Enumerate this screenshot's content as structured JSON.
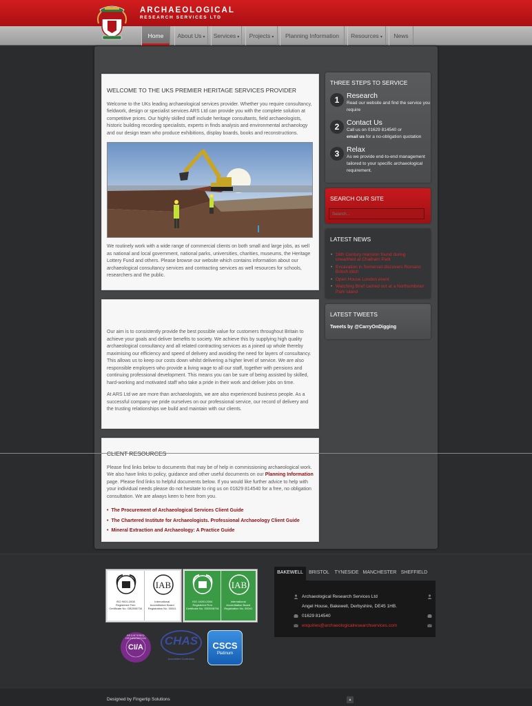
{
  "header": {
    "title_line1": "ARCHAEOLOGICAL",
    "title_line2": "RESEARCH SERVICES LTD"
  },
  "nav": {
    "items": [
      {
        "label": "Home",
        "active": true,
        "dropdown": false
      },
      {
        "label": "About Us",
        "active": false,
        "dropdown": true
      },
      {
        "label": "Services",
        "active": false,
        "dropdown": true
      },
      {
        "label": "Projects",
        "active": false,
        "dropdown": true
      },
      {
        "label": "Planning Information",
        "active": false,
        "dropdown": false
      },
      {
        "label": "Resources",
        "active": false,
        "dropdown": true
      },
      {
        "label": "News",
        "active": false,
        "dropdown": false
      }
    ],
    "caret": "▾"
  },
  "welcome": {
    "heading": "WELCOME TO THE UKS PREMIER HERITAGE SERVICES PROVIDER",
    "intro": "Welcome to the UKs leading archaeological services provider. Whether you require consultancy, fieldwork, design or specialist services ARS Ltd can provide you with the complete solution at competitive prices. Our highly skilled staff include heritage consultants, field archaeologists, historic building recording specialists, experts in finds analysis and environmental archaeology and our design team who produce exhibitions, display boards, books and reconstructions.",
    "body": "We routinely work with a wide range of commercial clients on both small and large jobs, as well as national and local government, national parks, universities, charities, museums, the Heritage Lottery Fund and others. Please browse our website which contains information about our archaeological consultancy services and contracting services as well resources for schools, researchers and the public."
  },
  "aim": {
    "p1": "Our aim is to consistently provide the best possible value for customers throughout Britain to achieve your goals and deliver benefits to society. We achieve this by supplying high quality archaeological consultancy and all related contracting services as a joined up whole thereby maximising our efficiency and speed of delivery and avoiding the need for layers of consultancy. This allows us to keep our costs down whilst delivering a higher level of service. We are also responsible employers who provide a living wage to all our staff, together with pensions and continuing professional development. This means you can be sure of being assisted by skilled, hard-working and motivated staff who take a pride in their work and deliver jobs on time.",
    "p2": "At ARS Ltd we are more than archaeologists, we are also experienced business people. As a successful company we pride ourselves on our professional service, our record of delivery and the trusting relationships we build and maintain with our clients."
  },
  "resources": {
    "heading": "CLIENT RESOURCES",
    "p1_start": "Please find links below to documents that may be of help in commissioning archaeological work. We also have links to policy, guidance and other useful documents on our ",
    "p1_link": "Planning Information",
    "p1_end": " page. Please find links to helpful documents below. If you would like further advice to help with your individual needs please do not hesitate to ring us on 01629 814540 for a free, no obligation consultation. We are always keen to here from you.",
    "links": [
      "The Procurement of Archaeological Services Client Guide",
      "The Chartered Institute for Archaeologists. Professional Archaeology Client Guide",
      "Mineral Extraction and Archaeology: A Practice Guide"
    ]
  },
  "steps": {
    "heading": "THREE STEPS TO SERVICE",
    "items": [
      {
        "num": "1",
        "title": "Research",
        "text": "Read our website and find the service you require"
      },
      {
        "num": "2",
        "title": "Contact Us",
        "text1": "Call us on 01629 814540 or",
        "text2_bold": "email us",
        "text2": " for a no-obligation quotation"
      },
      {
        "num": "3",
        "title": "Relax",
        "text": "As we provide end-to-end management tailored to your specific archaeological requirement."
      }
    ]
  },
  "search": {
    "heading": "SEARCH OUR SITE",
    "placeholder": "Search..."
  },
  "news": {
    "heading": "LATEST NEWS",
    "items": [
      "16th Century mansion found during unearthed at Chatham Park",
      "Excavation in Somerset discovers Romano British ditch",
      "Open House London event",
      "Watching Brief carried out at a Northumbrian Park island"
    ]
  },
  "tweets": {
    "heading": "LATEST TWEETS",
    "by": "Tweets by @CarryOnDigging"
  },
  "certs": {
    "cert1_left_a": "ISO 9001:2008",
    "cert1_left_b": "Registered Firm",
    "cert1_left_c": "Certificate No. GB2008734",
    "cert1_right_a": "International",
    "cert1_right_b": "Accreditation Board",
    "cert1_right_c": "Registration No. 00041",
    "cert2_left_a": "ISO 14001:2004",
    "cert2_left_b": "Registered Firm",
    "cert2_left_c": "Certificate No. GB2008734",
    "cert2_right_a": "International",
    "cert2_right_b": "Accreditation Board",
    "cert2_right_c": "Registration No. 00041",
    "cia_ring": "REGISTERED ORGANISATION",
    "cia": "CI/A",
    "chas": "CHAS",
    "chas_sub": "Accredited Contractor",
    "cscs": "CSCS",
    "cscs_sub": "Platinum"
  },
  "offices": {
    "tabs": [
      "BAKEWELL",
      "BRISTOL",
      "TYNESIDE",
      "MANCHESTER",
      "SHEFFIELD"
    ],
    "name": "Archaeological Research Services Ltd",
    "address": "Angel House, Bakewell, Derbyshire, DE45 1HB.",
    "phone": "01629 814540",
    "email": "enquiries@archaeologicalresearchservices.com"
  },
  "footer": {
    "designed_by": "Designed by Fingertip Solutions",
    "to_top": "▲"
  },
  "colors": {
    "brand_red": "#c81b1d",
    "link_red": "#8b0f12",
    "news_red": "#d42a2d",
    "cert_green": "#3a9a45",
    "cia_purple": "#7b2b8a",
    "chas_blue": "#3a4da0",
    "cscs_blue": "#1b72c9"
  }
}
